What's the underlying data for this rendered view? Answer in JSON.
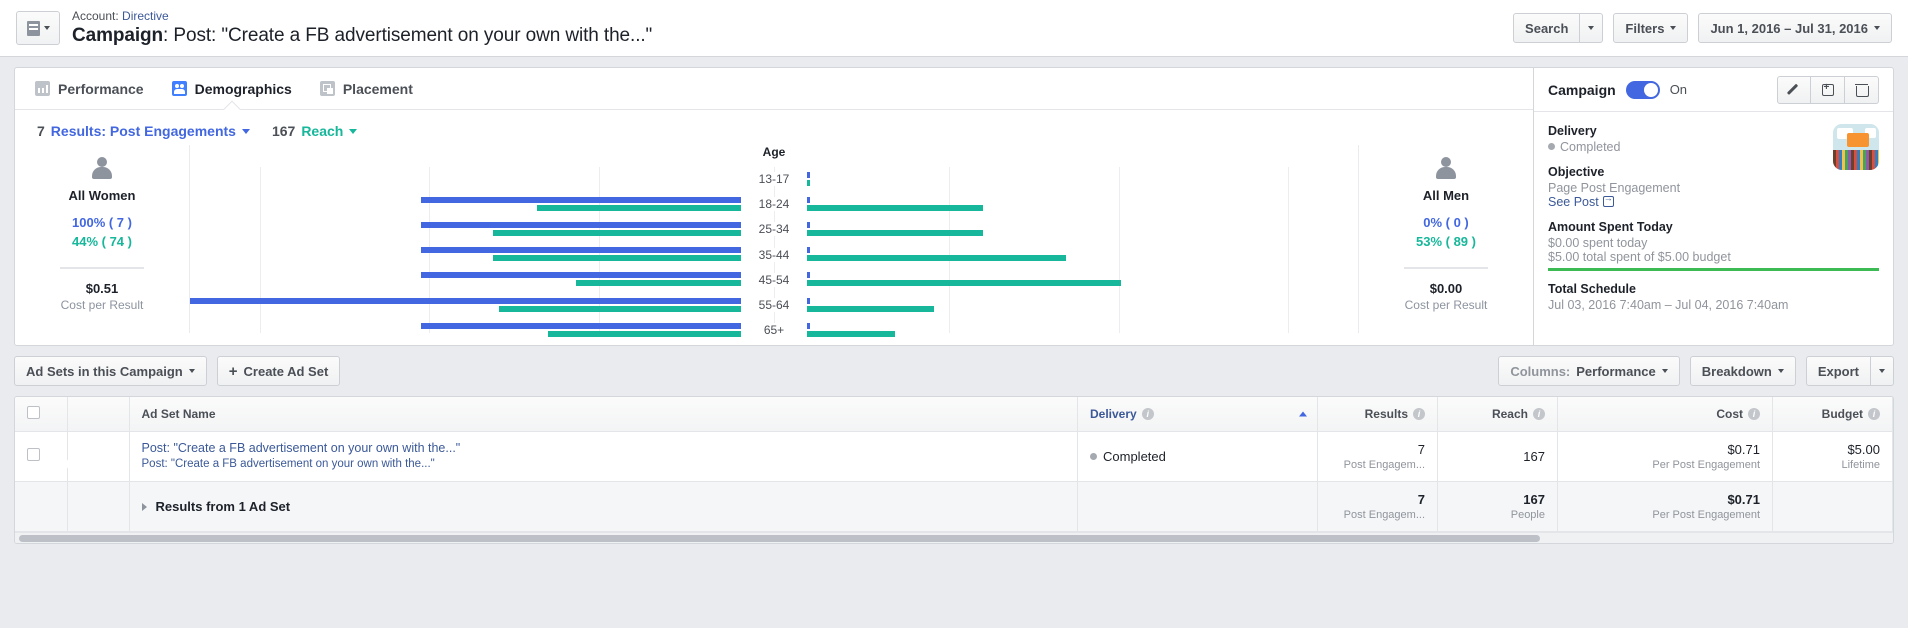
{
  "header": {
    "account_label": "Account:",
    "account_name": "Directive",
    "campaign_label": "Campaign",
    "campaign_name": ": Post: \"Create a FB advertisement on your own with the...\"",
    "search_button": "Search",
    "filters_button": "Filters",
    "date_range": "Jun 1, 2016 – Jul 31, 2016"
  },
  "tabs": [
    {
      "label": "Performance",
      "icon": "bar-chart-icon",
      "active": false
    },
    {
      "label": "Demographics",
      "icon": "people-icon",
      "active": true
    },
    {
      "label": "Placement",
      "icon": "placement-icon",
      "active": false
    }
  ],
  "metrics": {
    "results_value": "7",
    "results_label": "Results: Post Engagements",
    "reach_value": "167",
    "reach_label": "Reach"
  },
  "women": {
    "title": "All Women",
    "results_pct": "100% ( 7 )",
    "reach_pct": "44% ( 74 )",
    "cost": "$0.51",
    "cost_label": "Cost per Result"
  },
  "men": {
    "title": "All Men",
    "results_pct": "0% ( 0 )",
    "reach_pct": "53% ( 89 )",
    "cost": "$0.00",
    "cost_label": "Cost per Result"
  },
  "chart_data": {
    "type": "bar",
    "title": "Age",
    "subtype": "population-pyramid",
    "categories": [
      "13-17",
      "18-24",
      "25-34",
      "35-44",
      "45-54",
      "55-64",
      "65+"
    ],
    "series": [
      {
        "name": "Results: Post Engagements",
        "side": "women",
        "color": "#4267e0",
        "values": [
          0,
          58,
          58,
          58,
          58,
          100,
          58
        ]
      },
      {
        "name": "Reach",
        "side": "women",
        "color": "#16b79a",
        "values": [
          0,
          37,
          45,
          45,
          30,
          44,
          35
        ]
      },
      {
        "name": "Results: Post Engagements",
        "side": "men",
        "color": "#4267e0",
        "values": [
          0.5,
          0.5,
          0.5,
          0.5,
          0.5,
          0.5,
          0.5
        ]
      },
      {
        "name": "Reach",
        "side": "men",
        "color": "#16b79a",
        "values": [
          0.5,
          32,
          32,
          47,
          57,
          23,
          16
        ]
      }
    ],
    "xlabel": "",
    "ylabel": "Age",
    "grid": true,
    "legend": "none"
  },
  "panel": {
    "title": "Campaign",
    "toggle_state": "On",
    "edit_icon": "pencil-icon",
    "duplicate_icon": "duplicate-icon",
    "delete_icon": "trash-icon",
    "delivery_label": "Delivery",
    "delivery_value": "Completed",
    "objective_label": "Objective",
    "objective_value": "Page Post Engagement",
    "see_post": "See Post",
    "spent_label": "Amount Spent Today",
    "spent_today": "$0.00 spent today",
    "spent_total": "$5.00 total spent of $5.00 budget",
    "progress_color": "#3cba54",
    "schedule_label": "Total Schedule",
    "schedule_value": "Jul 03, 2016 7:40am – Jul 04, 2016 7:40am"
  },
  "toolbar": {
    "adsets_dropdown": "Ad Sets in this Campaign",
    "create_adset": "Create Ad Set",
    "columns_prefix": "Columns:",
    "columns_value": "Performance",
    "breakdown": "Breakdown",
    "export": "Export"
  },
  "table": {
    "columns": [
      "Ad Set Name",
      "Delivery",
      "Results",
      "Reach",
      "Cost",
      "Budget"
    ],
    "sorted_column": "Delivery",
    "sort_direction": "asc",
    "rows": [
      {
        "name_line1": "Post: \"Create a FB advertisement on your own with the...\"",
        "name_line2": "Post: \"Create a FB advertisement on your own with the...\"",
        "delivery": "Completed",
        "results": "7",
        "results_sub": "Post Engagem...",
        "reach": "167",
        "reach_sub": "",
        "cost": "$0.71",
        "cost_sub": "Per Post Engagement",
        "budget": "$5.00",
        "budget_sub": "Lifetime"
      }
    ],
    "total": {
      "label": "Results from 1 Ad Set",
      "results": "7",
      "results_sub": "Post Engagem...",
      "reach": "167",
      "reach_sub": "People",
      "cost": "$0.71",
      "cost_sub": "Per Post Engagement",
      "budget": "",
      "budget_sub": ""
    }
  }
}
